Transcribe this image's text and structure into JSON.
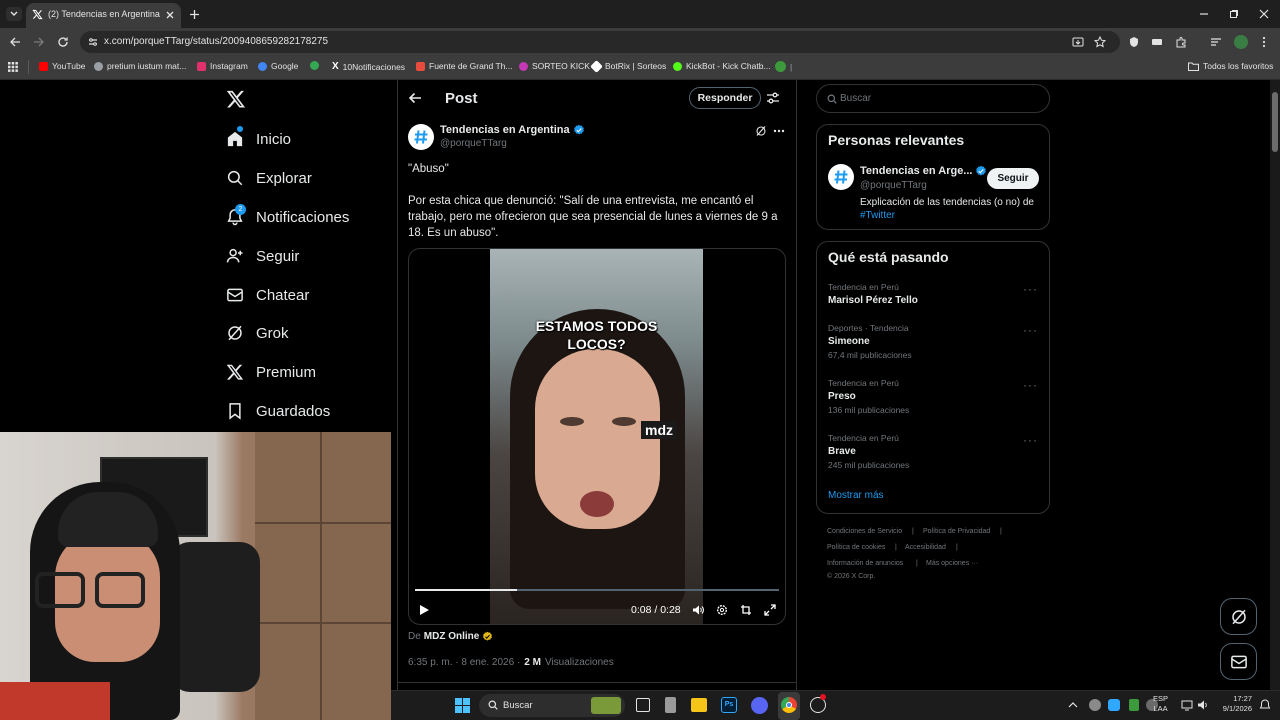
{
  "browser": {
    "tab_title": "(2) Tendencias en Argentina en X",
    "url": "x.com/porqueTTarg/status/2009408659282178275",
    "bookmarks": [
      {
        "label": "YouTube",
        "color": "#ff0000"
      },
      {
        "label": "pretium iustum mat...",
        "color": "#9aa0a6"
      },
      {
        "label": "Instagram",
        "color": "#e1306c"
      },
      {
        "label": "Google",
        "color": "#4285f4"
      },
      {
        "label": "",
        "color": "#34a853"
      },
      {
        "label": "10Notificaciones",
        "color": "#ffffff"
      },
      {
        "label": "Fuente de Grand Th...",
        "color": "#e74c3c"
      },
      {
        "label": "SORTEO KICK",
        "color": "#c239b3"
      },
      {
        "label": "BotRix | Sorteos",
        "color": "#ffffff"
      },
      {
        "label": "KickBot - Kick Chatb...",
        "color": "#53fc18"
      }
    ],
    "all_bookmarks": "Todos los favoritos"
  },
  "nav": {
    "items": [
      {
        "label": "Inicio",
        "icon": "home-icon"
      },
      {
        "label": "Explorar",
        "icon": "search-icon"
      },
      {
        "label": "Notificaciones",
        "icon": "bell-icon",
        "badge": "2"
      },
      {
        "label": "Seguir",
        "icon": "follow-icon"
      },
      {
        "label": "Chatear",
        "icon": "mail-icon"
      },
      {
        "label": "Grok",
        "icon": "grok-icon"
      },
      {
        "label": "Premium",
        "icon": "x-logo-icon"
      },
      {
        "label": "Guardados",
        "icon": "bookmark-icon"
      }
    ]
  },
  "post": {
    "header_title": "Post",
    "reply_button": "Responder",
    "author_name": "Tendencias en Argentina",
    "author_handle": "@porqueTTarg",
    "text_1": "\"Abuso\"",
    "text_2": "Por esta chica que denunció: \"Salí de una entrevista, me encantó el trabajo, pero me ofrecieron que sea presencial de lunes a viernes de 9 a 18. Es un abuso\".",
    "video_caption_1": "ESTAMOS TODOS",
    "video_caption_2": "LOCOS?",
    "video_watermark": "mdz",
    "video_time": "0:08 / 0:28",
    "video_progress": 0.28,
    "source_prefix": "De",
    "source_name": "MDZ Online",
    "timestamp": "6:35 p. m. · 8 ene. 2026 ·",
    "views_count": "2 M",
    "views_label": "Visualizaciones"
  },
  "sidebar": {
    "search_placeholder": "Buscar",
    "relevant_title": "Personas relevantes",
    "relevant_name": "Tendencias en Arge...",
    "relevant_handle": "@porqueTTarg",
    "relevant_bio": "Explicación de las tendencias (o no) de",
    "relevant_hashtag": "#Twitter",
    "follow_button": "Seguir",
    "whats_happening_title": "Qué está pasando",
    "trends": [
      {
        "meta": "Tendencia en Perú",
        "name": "Marisol Pérez Tello",
        "posts": ""
      },
      {
        "meta": "Deportes · Tendencia",
        "name": "Simeone",
        "posts": "67,4 mil publicaciones"
      },
      {
        "meta": "Tendencia en Perú",
        "name": "Preso",
        "posts": "136 mil publicaciones"
      },
      {
        "meta": "Tendencia en Perú",
        "name": "Brave",
        "posts": "245 mil publicaciones"
      }
    ],
    "show_more": "Mostrar más",
    "footer": {
      "terms": "Condiciones de Servicio",
      "privacy": "Política de Privacidad",
      "cookies": "Política de cookies",
      "accessibility": "Accesibilidad",
      "ads": "Información de anuncios",
      "more": "Más opciones ···",
      "copyright": "© 2026 X Corp."
    }
  },
  "taskbar": {
    "search_placeholder": "Buscar",
    "lang_1": "ESP",
    "lang_2": "LAA",
    "time": "17:27",
    "date": "9/1/2026"
  },
  "colors": {
    "accent": "#1d9bf0",
    "verified": "#1d9bf0",
    "gold_verified": "#e2b719"
  }
}
